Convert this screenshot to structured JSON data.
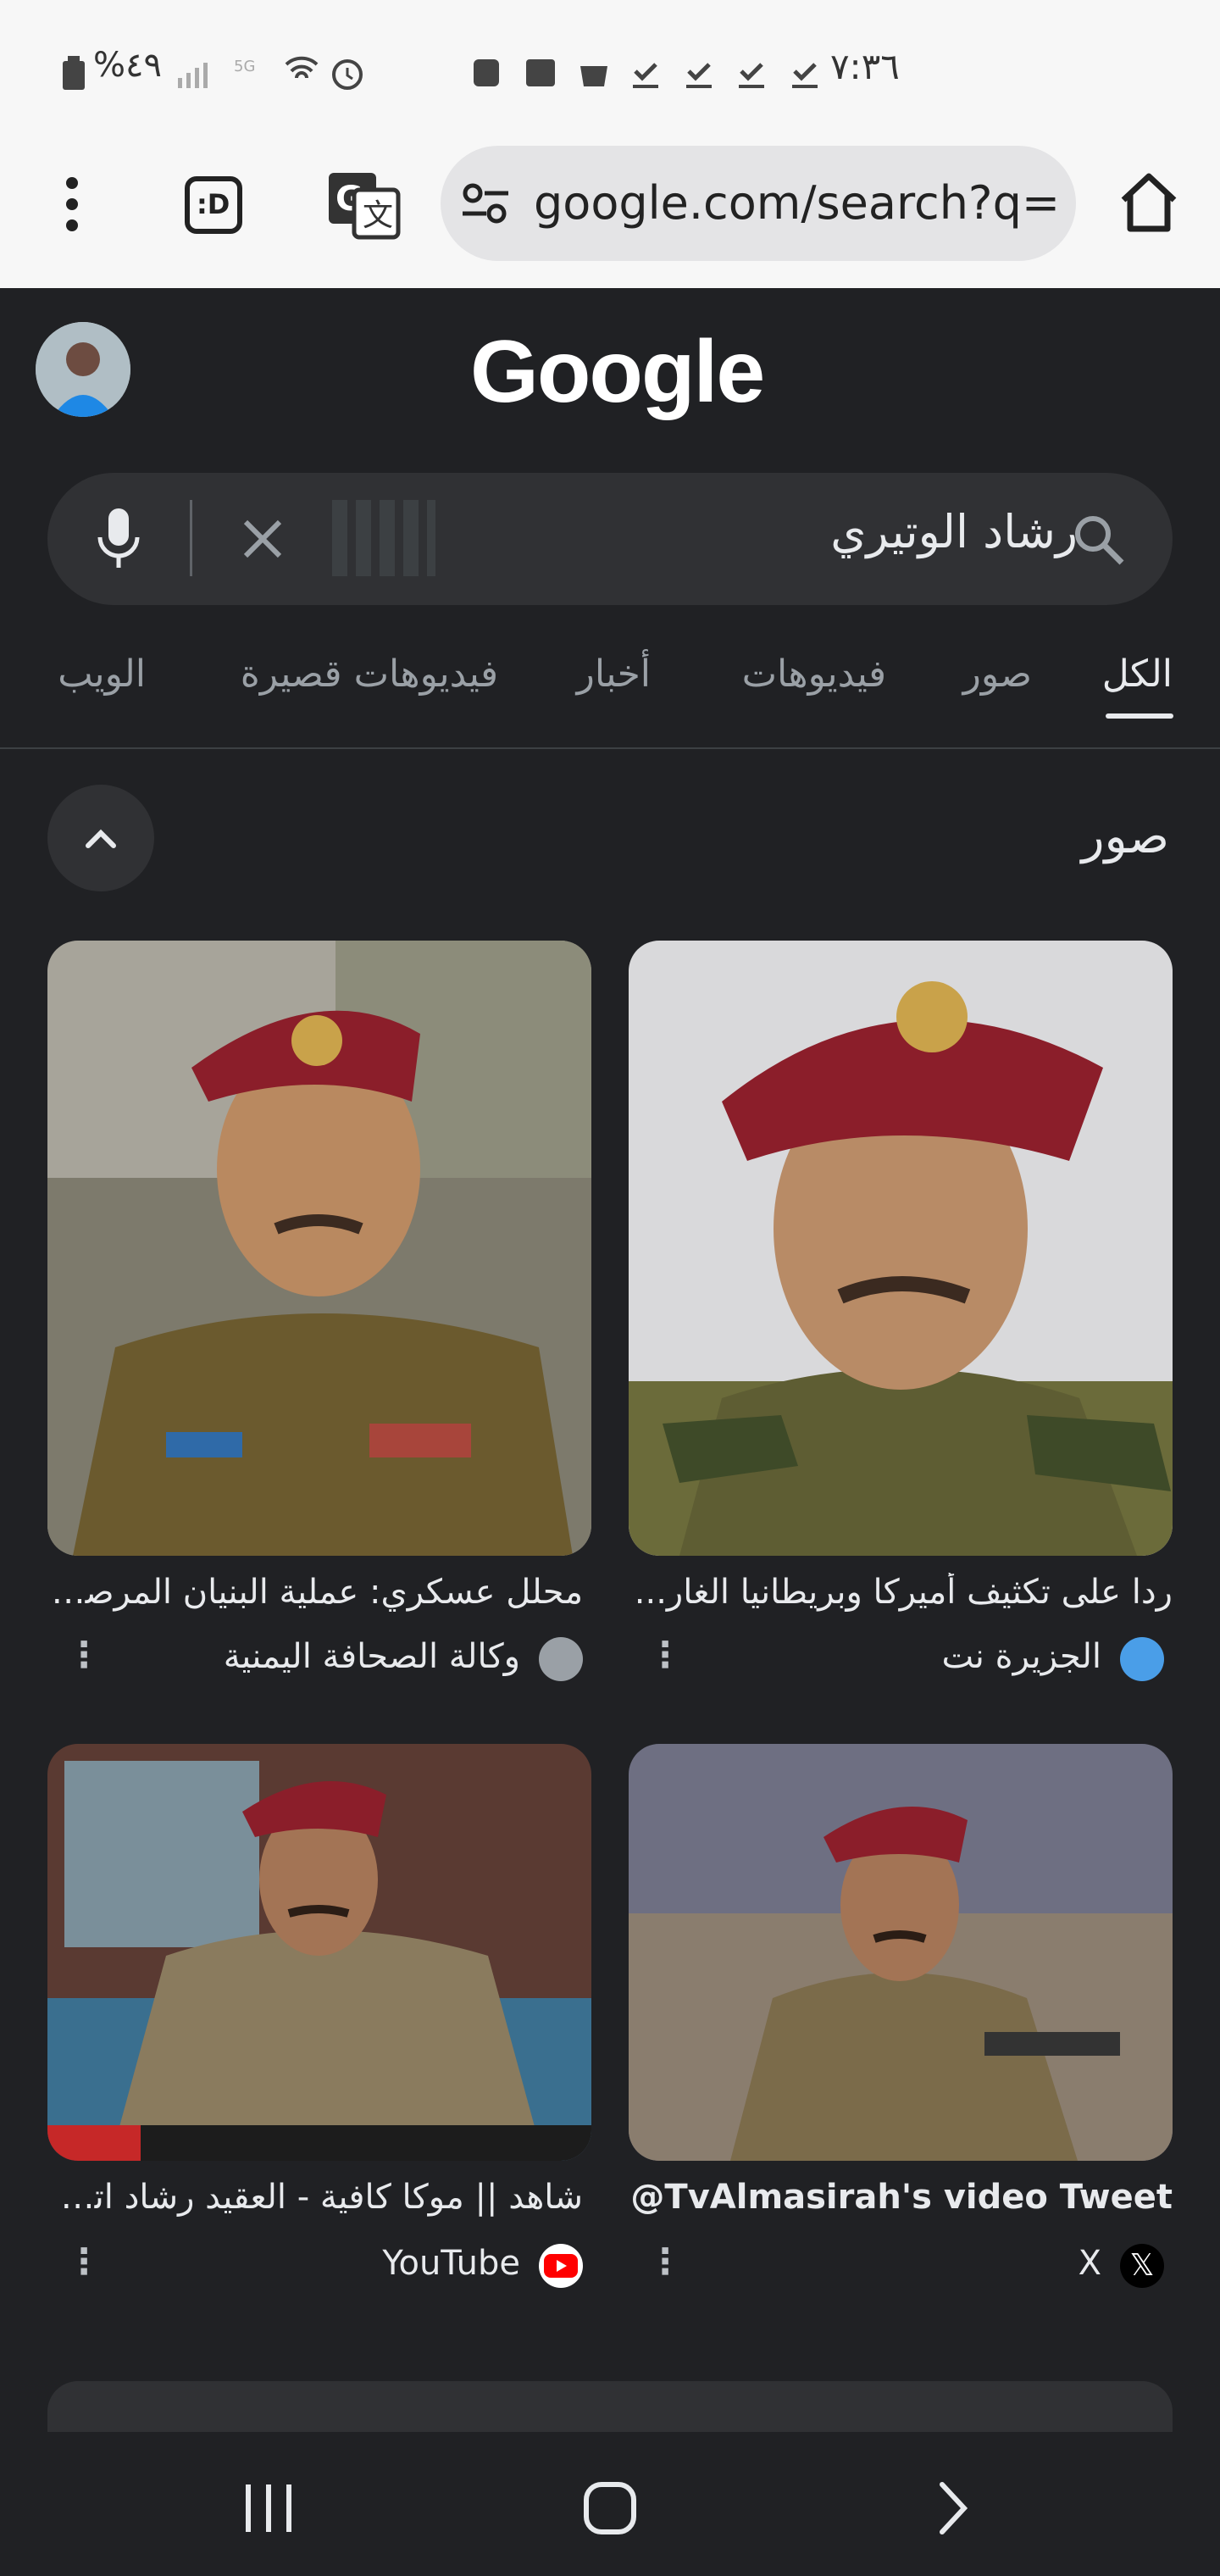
{
  "status_bar": {
    "time": "٧:٣٦",
    "battery": "%٤٩",
    "network": "5G"
  },
  "browser": {
    "url": "google.com/search?q=رشاد",
    "menu_icon": "kebab-menu-icon",
    "tabs_icon": "tab-switcher-icon",
    "tabs_label": ":D",
    "translate_icon": "translate-icon",
    "site_settings_icon": "tune-icon",
    "home_icon": "home-icon"
  },
  "google": {
    "logo": "Google"
  },
  "search": {
    "query": "رشاد الوتيري"
  },
  "tabs": [
    {
      "label": "الكل",
      "active": true
    },
    {
      "label": "صور",
      "active": false
    },
    {
      "label": "فيديوهات",
      "active": false
    },
    {
      "label": "أخبار",
      "active": false
    },
    {
      "label": "فيديوهات قصيرة",
      "active": false
    },
    {
      "label": "الويب",
      "active": false
    }
  ],
  "images_section": {
    "title": "صور",
    "results": [
      {
        "caption": "ردا على تكثيف أميركا وبريطانيا الغار...",
        "source": "الجزيرة نت",
        "source_color": "#4a9ee8"
      },
      {
        "caption": "محلل عسكري: عملية البنيان المرصو...",
        "source": "وكالة الصحافة اليمنية",
        "source_color": "#9aa0a6"
      },
      {
        "caption": "TvAlmasirah's video Tweet@",
        "source": "X",
        "source_color": "#ffffff"
      },
      {
        "caption": "شاهد || موكا كافية - العقيد رشاد اتي...",
        "source": "YouTube",
        "source_color": "#ff0000"
      }
    ]
  }
}
